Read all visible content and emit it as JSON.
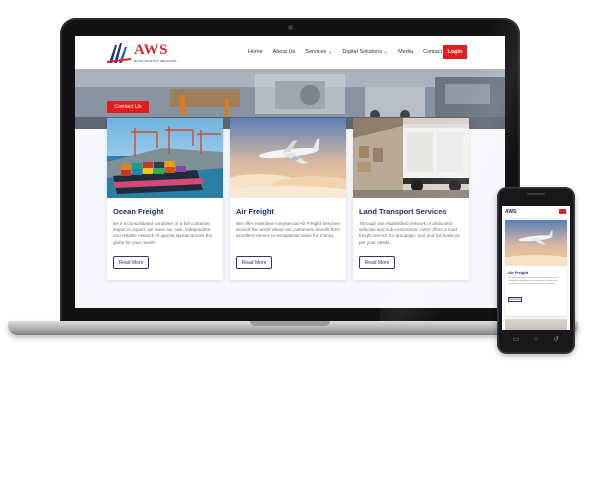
{
  "site": {
    "logo": {
      "text": "AWS",
      "tagline": "ROAD WORTHY SERVICES"
    },
    "nav": [
      {
        "label": "Home"
      },
      {
        "label": "About Us"
      },
      {
        "label": "Services ⌄"
      },
      {
        "label": "Digital Solutions ⌄"
      },
      {
        "label": "Media"
      },
      {
        "label": "Contact Us"
      }
    ],
    "login_label": "Login",
    "hero": {
      "contact_label": "Contact Us"
    }
  },
  "cards": [
    {
      "title": "Ocean Freight",
      "body": "Be it a consolidated container or a full container, import or export, we have our own, independent and reliable network of agents spread across the globe for your needs.",
      "button": "Read More",
      "image": "container-ship-port-image"
    },
    {
      "title": "Air Freight",
      "body": "We offer extensive commercial Air Freight Services around the world where our customers benefit from excellent service to exceptional value for money.",
      "button": "Read More",
      "image": "airplane-sky-image"
    },
    {
      "title": "Land Transport Services",
      "body": "Through our established network of dedicated vehicles and sub-contractors, AWS offers a road freight service for groupage, part and full loads as per your needs.",
      "button": "Read More",
      "image": "truck-loading-dock-image"
    }
  ],
  "phone": {
    "logo": "AWS",
    "card": {
      "title": "Air Freight",
      "body": "We offer extensive commercial Air Freight Services around the world where our customers benefit from excellent service to exceptional value for money.",
      "button": "Read More"
    }
  },
  "colors": {
    "brand_red": "#e01e1e",
    "brand_navy": "#1d2a6b",
    "page_bg": "#f4f8fc"
  }
}
